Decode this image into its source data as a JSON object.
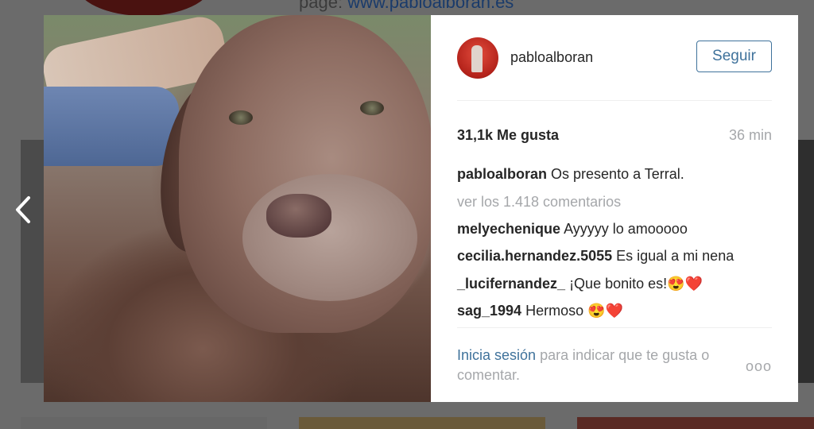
{
  "background": {
    "header_prefix": "page: ",
    "header_link": "www.pabloalboran.es"
  },
  "post": {
    "owner_username": "pabloalboran",
    "follow_label": "Seguir",
    "likes": "31,1k Me gusta",
    "time": "36 min",
    "caption": {
      "user": "pabloalboran",
      "text": "Os presento a Terral."
    },
    "view_all_comments": "ver los 1.418 comentarios",
    "comments": [
      {
        "user": "melyechenique",
        "text": "Ayyyyy lo amooooo"
      },
      {
        "user": "cecilia.hernandez.5055",
        "text": "Es igual a mi nena"
      },
      {
        "user": "_lucifernandez_",
        "text": "¡Que bonito es!😍❤️"
      },
      {
        "user": "sag_1994",
        "text": "Hermoso 😍❤️"
      }
    ],
    "login_link": "Inicia sesión",
    "login_rest": " para indicar que te gusta o comentar.",
    "more_label": "ooo"
  },
  "colors": {
    "accent": "#3f729b",
    "muted": "#a5a7aa",
    "text": "#262626"
  },
  "icons": {
    "prev": "chevron-left-icon"
  }
}
